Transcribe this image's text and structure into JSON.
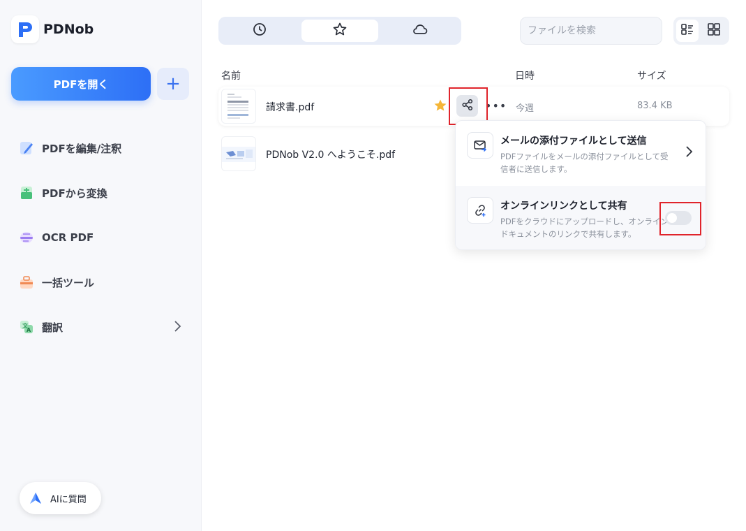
{
  "app": {
    "name": "PDNob"
  },
  "sidebar": {
    "open_pdf_label": "PDFを開く",
    "add_label": "+",
    "items": [
      {
        "label": "PDFを編集/注釈",
        "icon": "edit-icon"
      },
      {
        "label": "PDFから変換",
        "icon": "convert-icon"
      },
      {
        "label": "OCR PDF",
        "icon": "ocr-icon"
      },
      {
        "label": "一括ツール",
        "icon": "batch-tool-icon"
      },
      {
        "label": "翻訳",
        "icon": "translate-icon"
      }
    ],
    "ai_label": "AIに質問"
  },
  "toolbar": {
    "tabs": [
      {
        "icon": "clock-icon",
        "name": "recent"
      },
      {
        "icon": "star-icon",
        "name": "favorites",
        "active": true
      },
      {
        "icon": "cloud-icon",
        "name": "cloud"
      }
    ],
    "search_placeholder": "ファイルを検索",
    "view_modes": [
      "list-view-icon",
      "grid-view-icon"
    ]
  },
  "file_list": {
    "columns": {
      "name": "名前",
      "date": "日時",
      "size": "サイズ"
    },
    "rows": [
      {
        "name": "請求書.pdf",
        "date": "今週",
        "size": "83.4 KB",
        "favorite": true,
        "selected": true
      },
      {
        "name": "PDNob V2.0 へようこそ.pdf",
        "date": "",
        "size": ""
      }
    ]
  },
  "share_popup": {
    "email": {
      "title": "メールの添付ファイルとして送信",
      "desc": "PDFファイルをメールの添付ファイルとして受信者に送信します。"
    },
    "link": {
      "title": "オンラインリンクとして共有",
      "desc": "PDFをクラウドにアップロードし、オンラインドキュメントのリンクで共有します。",
      "toggle_on": false
    }
  },
  "colors": {
    "accent": "#2d6ff6",
    "highlight": "#e0242b",
    "star": "#f5b638"
  }
}
